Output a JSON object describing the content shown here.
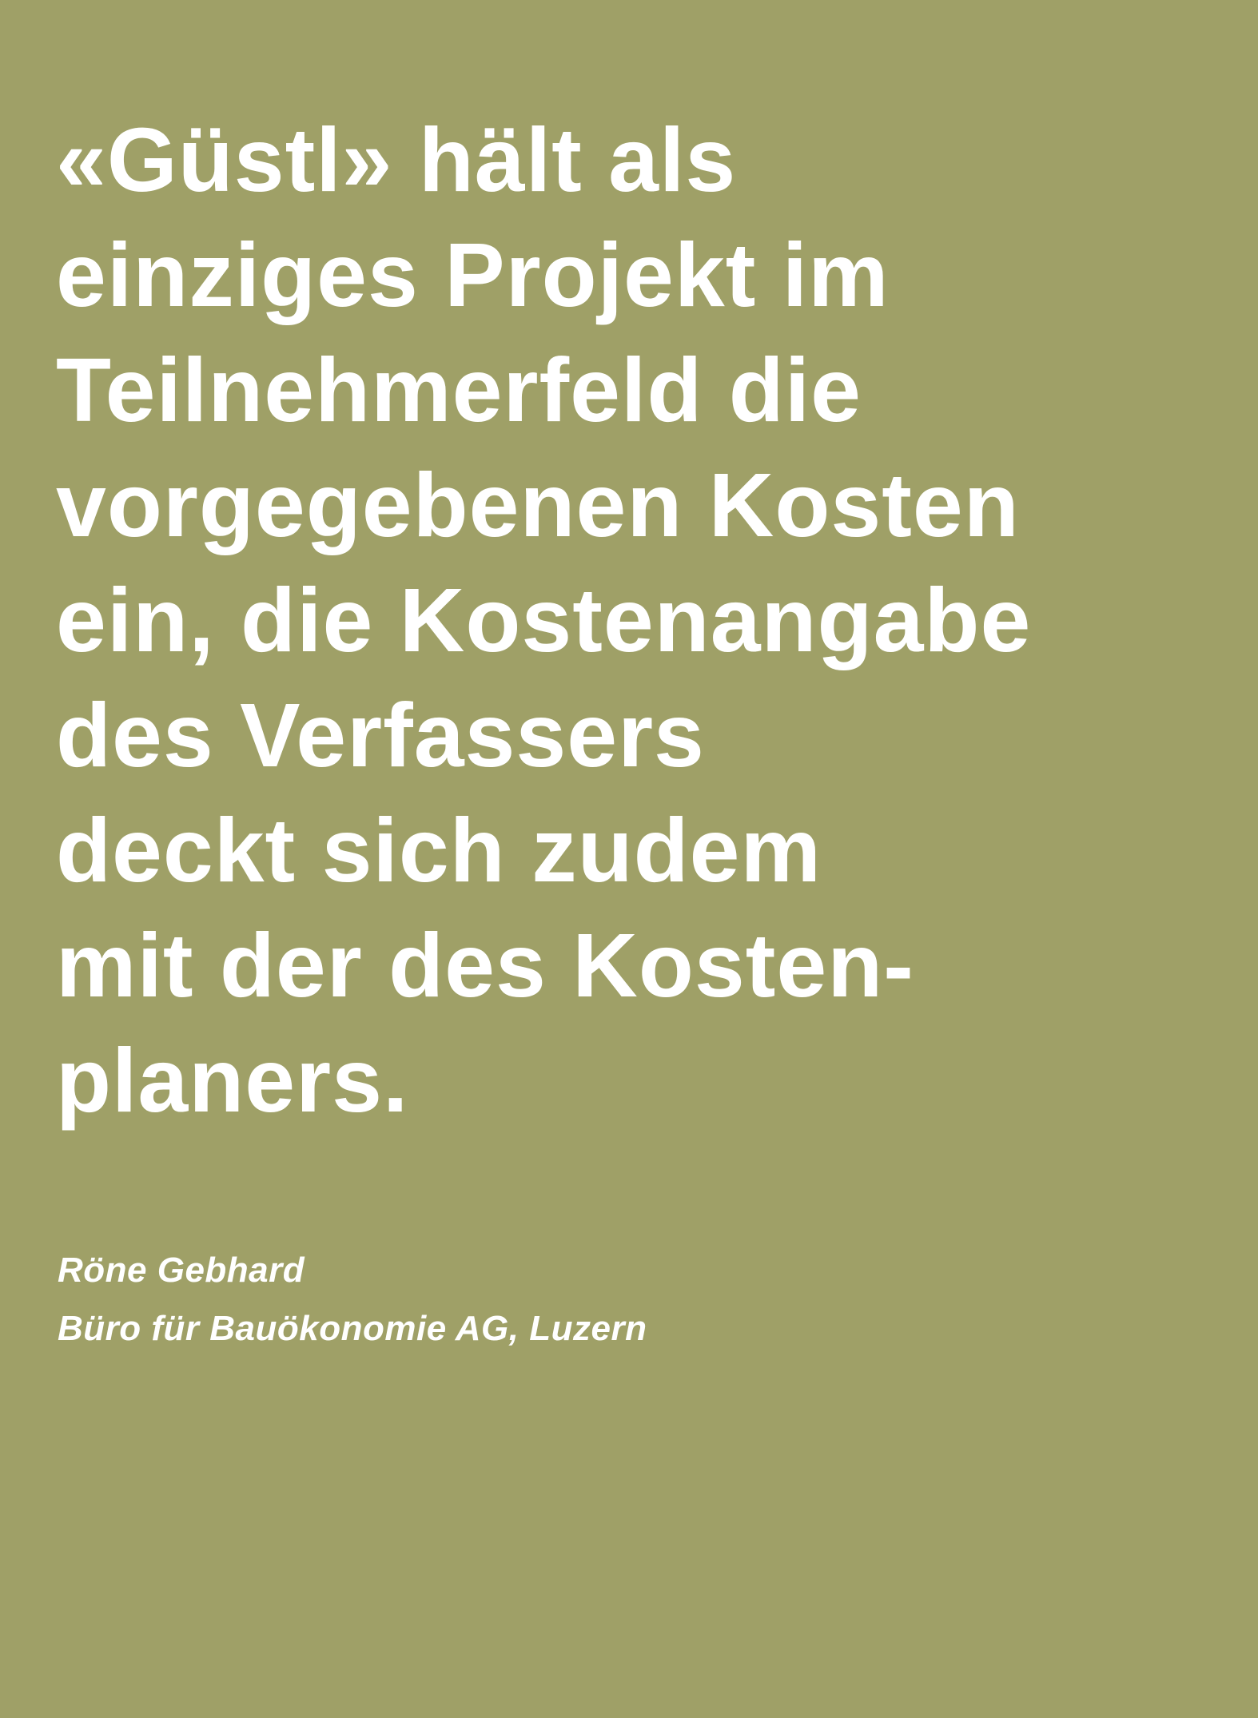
{
  "colors": {
    "background": "#9fa067",
    "text": "#ffffff"
  },
  "quote": {
    "lines": [
      "«Güstl» hält als",
      "einziges Projekt im",
      "Teilnehmerfeld die",
      "vorgegebenen Kosten",
      "ein, die Kostenangabe",
      "des Verfassers",
      "deckt sich zudem",
      "mit der des Kosten-",
      "planers."
    ]
  },
  "attribution": {
    "name": "Röne Gebhard",
    "organization": "Büro für Bauökonomie AG, Luzern"
  }
}
